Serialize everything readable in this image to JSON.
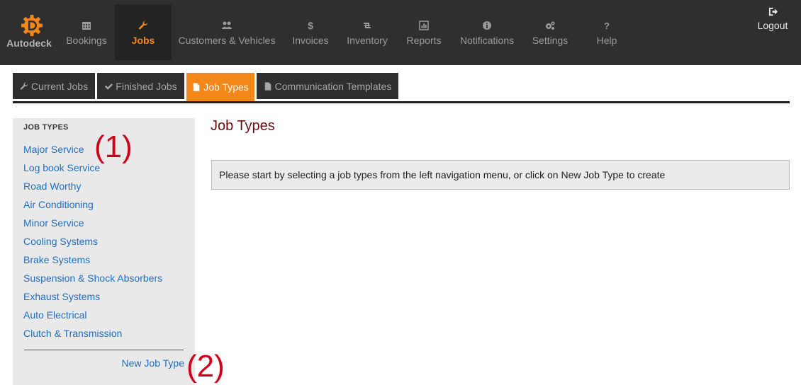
{
  "brand": {
    "name": "Autodeck",
    "logo_icon": "gear-d-logo-icon",
    "logo_color": "#f48719"
  },
  "nav": {
    "items": [
      {
        "label": "Bookings",
        "icon": "calendar-icon",
        "active": false
      },
      {
        "label": "Jobs",
        "icon": "wrench-icon",
        "active": true
      },
      {
        "label": "Customers & Vehicles",
        "icon": "users-icon",
        "active": false
      },
      {
        "label": "Invoices",
        "icon": "dollar-icon",
        "active": false
      },
      {
        "label": "Inventory",
        "icon": "retweet-icon",
        "active": false
      },
      {
        "label": "Reports",
        "icon": "chart-icon",
        "active": false
      },
      {
        "label": "Notifications",
        "icon": "info-icon",
        "active": false
      },
      {
        "label": "Settings",
        "icon": "gears-icon",
        "active": false
      },
      {
        "label": "Help",
        "icon": "question-icon",
        "active": false
      }
    ],
    "logout": {
      "label": "Logout",
      "icon": "sign-out-icon"
    }
  },
  "tabs": [
    {
      "label": "Current Jobs",
      "icon": "wrench-icon",
      "active": false
    },
    {
      "label": "Finished Jobs",
      "icon": "check-icon",
      "active": false
    },
    {
      "label": "Job Types",
      "icon": "file-icon",
      "active": true
    },
    {
      "label": "Communication Templates",
      "icon": "file-icon",
      "active": false
    }
  ],
  "sidebar": {
    "heading": "JOB TYPES",
    "items": [
      "Major Service",
      "Log book Service",
      "Road Worthy",
      "Air Conditioning",
      "Minor Service",
      "Cooling Systems",
      "Brake Systems",
      "Suspension & Shock Absorbers",
      "Exhaust Systems",
      "Auto Electrical",
      "Clutch & Transmission"
    ],
    "new_job_type": "New Job Type"
  },
  "annotations": {
    "one": "(1)",
    "two": "(2)"
  },
  "main": {
    "title": "Job Types",
    "info_message": "Please start by selecting a job types from the left navigation menu, or click on New Job Type to create"
  },
  "colors": {
    "accent": "#f48719",
    "topbar": "#2f2f2f",
    "link": "#1f6fbf",
    "title": "#6b0f0f",
    "annotation": "#d0021b"
  }
}
